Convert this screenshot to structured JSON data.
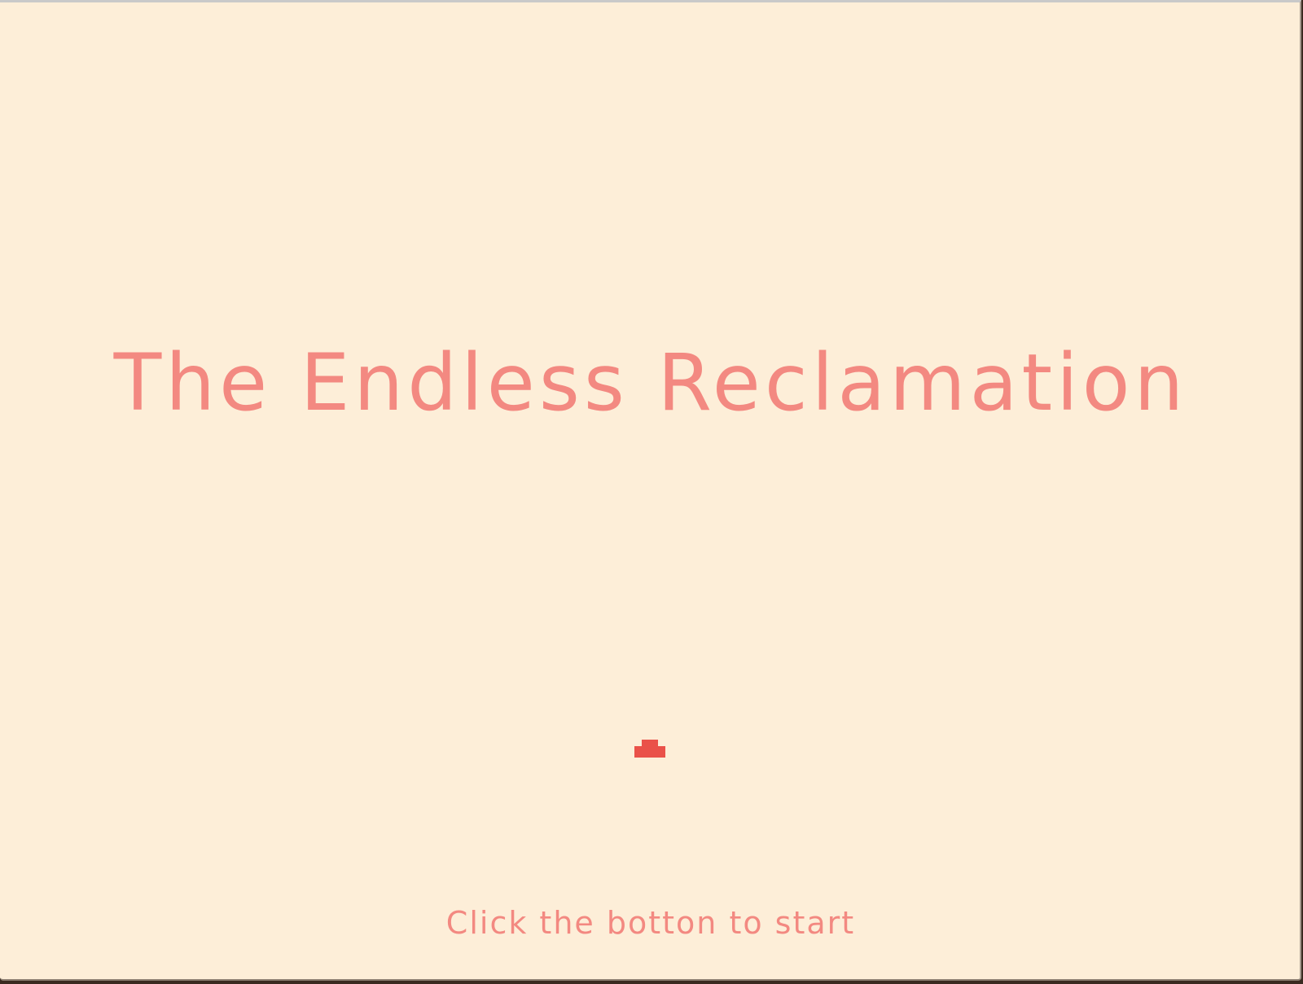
{
  "game": {
    "title": "The Endless Reclamation",
    "hint": "Click the botton to start"
  },
  "start_button": {
    "icon": "start-button-icon"
  },
  "colors": {
    "background": "#fdeed8",
    "text": "#f38981",
    "accent": "#ea5149"
  }
}
